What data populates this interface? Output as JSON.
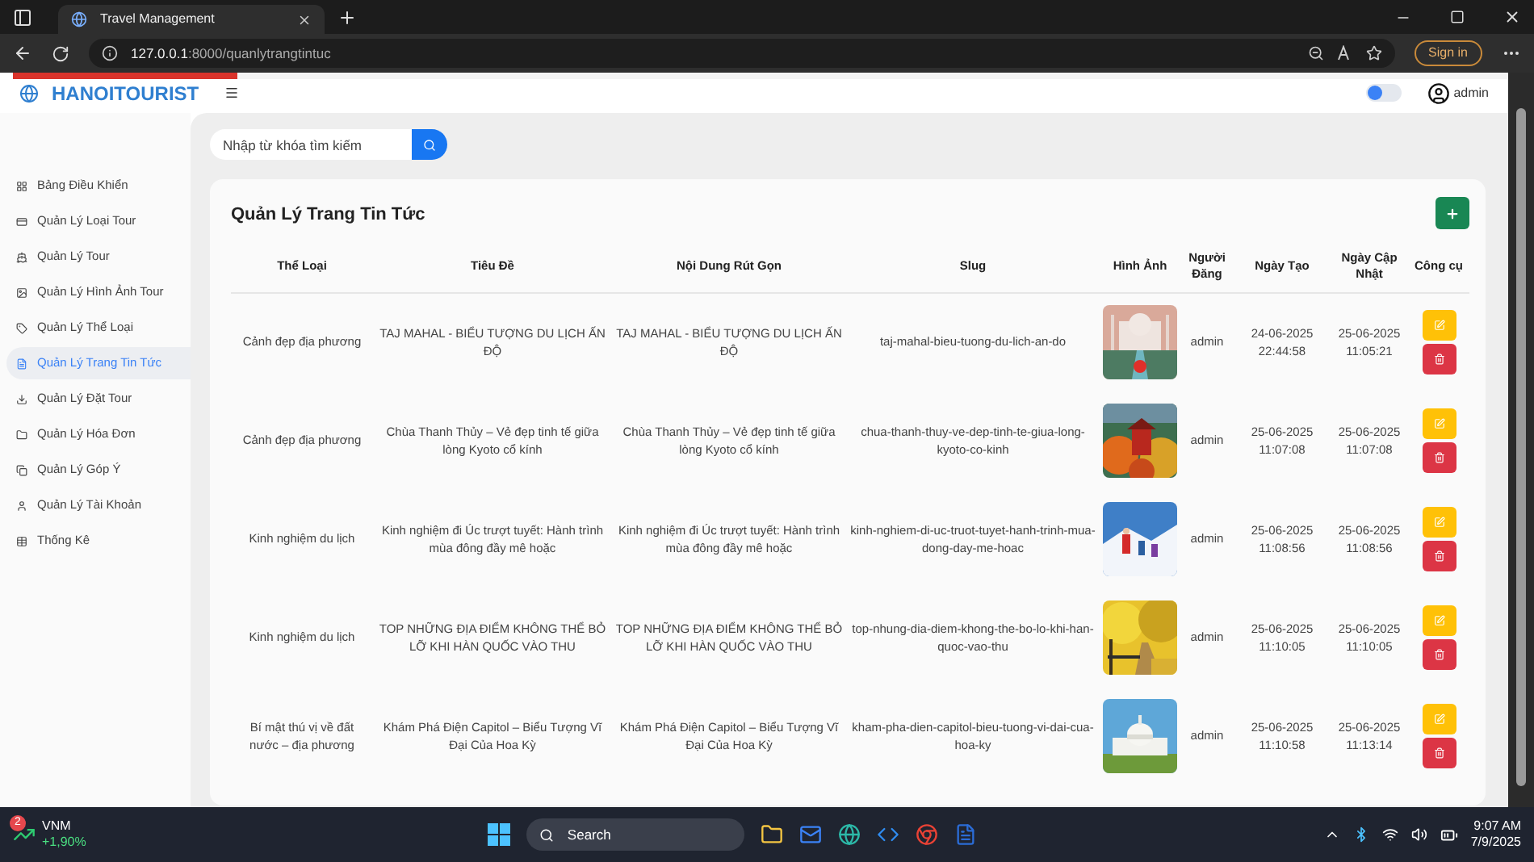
{
  "browser": {
    "tab_title": "Travel Management",
    "url_host": "127.0.0.1",
    "url_path": ":8000/quanlytrangtintuc",
    "sign_in": "Sign in",
    "loading": {
      "level": 0.15
    }
  },
  "header": {
    "brand": "HANOITOURIST",
    "dark_mode": false,
    "user": "admin"
  },
  "sidebar": {
    "items": [
      {
        "label": "Bảng Điều Khiển",
        "selected": false
      },
      {
        "label": "Quản Lý Loại Tour",
        "selected": false
      },
      {
        "label": "Quản Lý Tour",
        "selected": false
      },
      {
        "label": "Quản Lý Hình Ảnh Tour",
        "selected": false
      },
      {
        "label": "Quản Lý Thể Loại",
        "selected": false
      },
      {
        "label": "Quản Lý Trang Tin Tức",
        "selected": true
      },
      {
        "label": "Quản Lý Đặt Tour",
        "selected": false
      },
      {
        "label": "Quản Lý Hóa Đơn",
        "selected": false
      },
      {
        "label": "Quản Lý Góp Ý",
        "selected": false
      },
      {
        "label": "Quản Lý Tài Khoản",
        "selected": false
      },
      {
        "label": "Thống Kê",
        "selected": false
      }
    ]
  },
  "search": {
    "placeholder": "Nhập từ khóa tìm kiếm"
  },
  "page_title": "Quản Lý Trang Tin Tức",
  "table": {
    "columns": [
      "Thể Loại",
      "Tiêu Đề",
      "Nội Dung Rút Gọn",
      "Slug",
      "Hình Ảnh",
      "Người Đăng",
      "Ngày Tạo",
      "Ngày Cập Nhật",
      "Công cụ"
    ],
    "rows": [
      {
        "category": "Cảnh đẹp địa phương",
        "title": "TAJ MAHAL - BIỂU TƯỢNG DU LỊCH ẤN ĐỘ",
        "summary": "TAJ MAHAL - BIỂU TƯỢNG DU LỊCH ẤN ĐỘ",
        "slug": "taj-mahal-bieu-tuong-du-lich-an-do",
        "author": "admin",
        "created": "24-06-2025 22:44:58",
        "updated": "25-06-2025 11:05:21"
      },
      {
        "category": "Cảnh đẹp địa phương",
        "title": "Chùa Thanh Thủy – Vẻ đẹp tinh tế giữa lòng Kyoto cổ kính",
        "summary": "Chùa Thanh Thủy – Vẻ đẹp tinh tế giữa lòng Kyoto cổ kính",
        "slug": "chua-thanh-thuy-ve-dep-tinh-te-giua-long-kyoto-co-kinh",
        "author": "admin",
        "created": "25-06-2025 11:07:08",
        "updated": "25-06-2025 11:07:08"
      },
      {
        "category": "Kinh nghiệm du lịch",
        "title": "Kinh nghiệm đi Úc trượt tuyết: Hành trình mùa đông đầy mê hoặc",
        "summary": "Kinh nghiệm đi Úc trượt tuyết: Hành trình mùa đông đầy mê hoặc",
        "slug": "kinh-nghiem-di-uc-truot-tuyet-hanh-trinh-mua-dong-day-me-hoac",
        "author": "admin",
        "created": "25-06-2025 11:08:56",
        "updated": "25-06-2025 11:08:56"
      },
      {
        "category": "Kinh nghiệm du lịch",
        "title": "TOP NHỮNG ĐỊA ĐIỂM KHÔNG THỂ BỎ LỠ KHI HÀN QUỐC VÀO THU",
        "summary": "TOP NHỮNG ĐỊA ĐIỂM KHÔNG THỂ BỎ LỠ KHI HÀN QUỐC VÀO THU",
        "slug": "top-nhung-dia-diem-khong-the-bo-lo-khi-han-quoc-vao-thu",
        "author": "admin",
        "created": "25-06-2025 11:10:05",
        "updated": "25-06-2025 11:10:05"
      },
      {
        "category": "Bí mật thú vị về đất nước – địa phương",
        "title": "Khám Phá Điện Capitol – Biểu Tượng Vĩ Đại Của Hoa Kỳ",
        "summary": "Khám Phá Điện Capitol – Biểu Tượng Vĩ Đại Của Hoa Kỳ",
        "slug": "kham-pha-dien-capitol-bieu-tuong-vi-dai-cua-hoa-ky",
        "author": "admin",
        "created": "25-06-2025 11:10:58",
        "updated": "25-06-2025 11:13:14"
      }
    ]
  },
  "taskbar": {
    "widget": {
      "badge": "2",
      "ticker": "VNM",
      "change": "+1,90%"
    },
    "search": "Search",
    "time": "9:07 AM",
    "date": "7/9/2025"
  }
}
